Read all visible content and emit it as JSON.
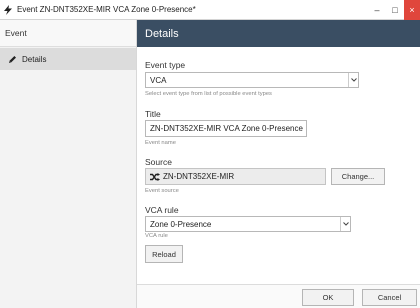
{
  "window": {
    "title": "Event ZN-DNT352XE-MIR VCA Zone 0-Presence*",
    "minimize_glyph": "–",
    "maximize_glyph": "□",
    "close_glyph": "×",
    "accent_close": "#e0463c"
  },
  "sidebar": {
    "header": "Event",
    "items": [
      {
        "label": "Details",
        "icon": "pencil-icon",
        "selected": true
      }
    ]
  },
  "main": {
    "header": "Details",
    "header_color": "#3a4e63"
  },
  "form": {
    "event_type": {
      "label": "Event type",
      "value": "VCA",
      "hint": "Select event type from list of possible event types"
    },
    "title": {
      "label": "Title",
      "value": "ZN-DNT352XE-MIR VCA Zone 0-Presence",
      "hint": "Event name"
    },
    "source": {
      "label": "Source",
      "value": "ZN-DNT352XE-MIR",
      "icon": "shuffle-icon",
      "hint": "Event source",
      "change_label": "Change..."
    },
    "vca_rule": {
      "label": "VCA rule",
      "value": "Zone 0-Presence",
      "hint": "VCA rule",
      "reload_label": "Reload"
    }
  },
  "footer": {
    "ok_label": "OK",
    "cancel_label": "Cancel"
  }
}
